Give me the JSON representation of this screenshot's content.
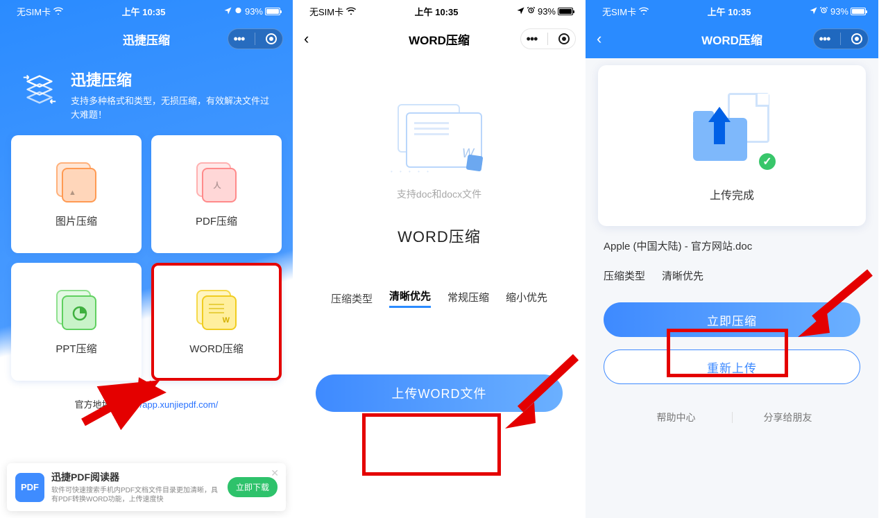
{
  "status": {
    "sim": "无SIM卡",
    "time": "上午 10:35",
    "battery": "93%"
  },
  "screen1": {
    "title": "迅捷压缩",
    "hero_title": "迅捷压缩",
    "hero_sub": "支持多种格式和类型，无损压缩，有效解决文件过大难题！",
    "cards": {
      "img": "图片压缩",
      "pdf": "PDF压缩",
      "ppt": "PPT压缩",
      "word": "WORD压缩"
    },
    "footer_prefix": "官方地址：",
    "footer_url": "http://app.xunjiepdf.com/",
    "ad": {
      "icon": "PDF",
      "title": "迅捷PDF阅读器",
      "sub": "软件可快速搜索手机内PDF文档文件目录更加清晰，具有PDF转换WORD功能，上传速度快",
      "btn": "立即下载"
    }
  },
  "screen2": {
    "title": "WORD压缩",
    "support": "支持doc和docx文件",
    "big": "WORD压缩",
    "opt_label": "压缩类型",
    "opts": {
      "a": "清晰优先",
      "b": "常规压缩",
      "c": "缩小优先"
    },
    "upload": "上传WORD文件"
  },
  "screen3": {
    "title": "WORD压缩",
    "done": "上传完成",
    "file": "Apple (中国大陆) - 官方网站.doc",
    "type_label": "压缩类型",
    "type_value": "清晰优先",
    "compress": "立即压缩",
    "reupload": "重新上传",
    "help": "帮助中心",
    "share": "分享给朋友"
  }
}
